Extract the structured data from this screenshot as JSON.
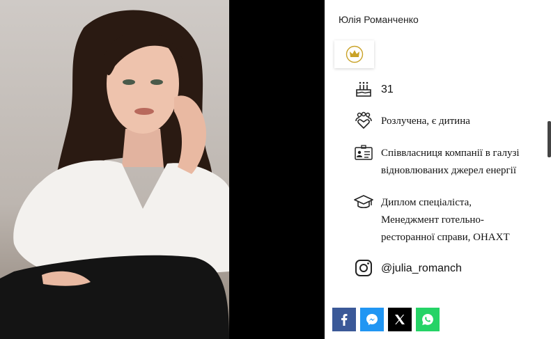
{
  "profile": {
    "name": "Юлія Романченко",
    "age": "31",
    "marital": "Розлучена, є дитина",
    "work_lines": [
      "Співвласниця компанії в галузі",
      "відновлюваних джерел енергії"
    ],
    "education_lines": [
      "Диплом спеціаліста,",
      "Менеджмент готельно-",
      "ресторанної справи, ОНАХТ"
    ],
    "instagram": "@julia_romanch"
  },
  "icons": {
    "crown": "crown-icon",
    "age": "birthday-cake-icon",
    "marital": "family-icon",
    "work": "id-card-icon",
    "education": "graduation-cap-icon",
    "instagram": "instagram-icon"
  },
  "share": [
    "facebook-icon",
    "messenger-icon",
    "x-icon",
    "whatsapp-icon"
  ],
  "colors": {
    "accent_gold": "#c9a227",
    "facebook": "#3b5998",
    "messenger": "#2196f3",
    "x": "#000000",
    "whatsapp": "#25d366"
  }
}
